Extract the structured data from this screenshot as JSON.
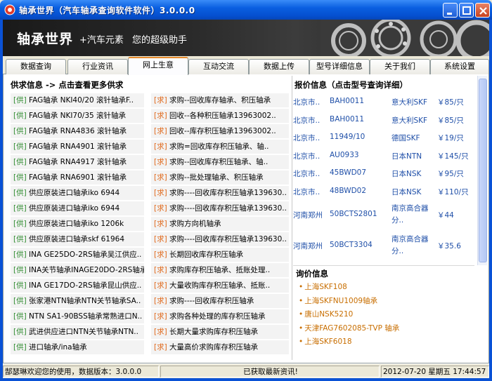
{
  "window": {
    "title": "轴承世界（汽车轴承查询软件软件）3.0.0.0",
    "icons": {
      "app": "bearing-app-icon",
      "minimize": "minimize-icon",
      "maximize": "maximize-icon",
      "close": "close-icon"
    }
  },
  "banner": {
    "brand": "轴承世界",
    "sub": "+汽车元素",
    "slogan": "您的超级助手"
  },
  "tabs": [
    {
      "label": "数据查询",
      "active": false
    },
    {
      "label": "行业资讯",
      "active": false
    },
    {
      "label": "网上生意",
      "active": true
    },
    {
      "label": "互动交流",
      "active": false
    },
    {
      "label": "数据上传",
      "active": false
    },
    {
      "label": "型号详细信息",
      "active": false
    },
    {
      "label": "关于我们",
      "active": false
    },
    {
      "label": "系统设置",
      "active": false
    }
  ],
  "supply_demand": {
    "header": "供求信息 -> 点击查看更多供求",
    "supply_tag": "[供]",
    "demand_tag": "[求]",
    "rows": [
      {
        "supply": "FAG轴承 NKI40/20 滚针轴承F..",
        "demand": "求购--回收库存轴承、积压轴承"
      },
      {
        "supply": "FAG轴承 NKI70/35 滚针轴承",
        "demand": "回收--各种积压轴承13963002.."
      },
      {
        "supply": "FAG轴承 RNA4836 滚针轴承",
        "demand": "回收--库存积压轴承13963002.."
      },
      {
        "supply": "FAG轴承 RNA4901 滚针轴承",
        "demand": "求购=回收库存积压轴承、轴.."
      },
      {
        "supply": "FAG轴承 RNA4917 滚针轴承",
        "demand": "求购--回收库存积压轴承、轴.."
      },
      {
        "supply": "FAG轴承 RNA6901 滚针轴承",
        "demand": "求购--批处理轴承、积压轴承"
      },
      {
        "supply": "供应原装进口轴承iko 6944",
        "demand": "求购----回收库存积压轴承139630.."
      },
      {
        "supply": "供应原装进口轴承iko 6944",
        "demand": "求购----回收库存积压轴承139630.."
      },
      {
        "supply": "供应原装进口轴承iko 1206k",
        "demand": "求购方向机轴承"
      },
      {
        "supply": "供应原装进口轴承skf 61964",
        "demand": "求购----回收库存积压轴承139630.."
      },
      {
        "supply": "INA GE25DO-2RS轴承吴江供应..",
        "demand": "长期回收库存积压轴承"
      },
      {
        "supply": "INA关节轴承INAGE20DO-2RS轴承",
        "demand": "求购库存积压轴承、抵账处理.."
      },
      {
        "supply": "INA GE17DO-2RS轴承昆山供应..",
        "demand": "大量收购库存积压轴承、抵账.."
      },
      {
        "supply": "张家港NTN轴承NTN关节轴承SA..",
        "demand": "求购----回收库存积压轴承"
      },
      {
        "supply": "NTN SA1-90BSS轴承常熟进口N..",
        "demand": "求购各种处理的库存积压轴承"
      },
      {
        "supply": "武进供应进口NTN关节轴承NTN..",
        "demand": "长期大量求购库存积压轴承"
      },
      {
        "supply": "进口轴承/ina轴承",
        "demand": "大量高价求购库存积压轴承"
      }
    ]
  },
  "quotes": {
    "header": "报价信息（点击型号查询详细）",
    "rows": [
      {
        "city": "北京市..",
        "model": "BAH0011",
        "brand": "意大利SKF",
        "price": "￥85/只"
      },
      {
        "city": "北京市..",
        "model": "BAH0011",
        "brand": "意大利SKF",
        "price": "￥85/只"
      },
      {
        "city": "北京市..",
        "model": "11949/10",
        "brand": "德国SKF",
        "price": "￥19/只"
      },
      {
        "city": "北京市..",
        "model": "AU0933",
        "brand": "日本NTN",
        "price": "￥145/只"
      },
      {
        "city": "北京市..",
        "model": "45BWD07",
        "brand": "日本NSK",
        "price": "￥95/只"
      },
      {
        "city": "北京市..",
        "model": "48BWD02",
        "brand": "日本NSK",
        "price": "￥110/只"
      },
      {
        "city": "河南郑州",
        "model": "50BCTS2801",
        "brand": "南京高合器分..",
        "price": "￥44"
      },
      {
        "city": "河南郑州",
        "model": "50BCT3304",
        "brand": "南京高合器分..",
        "price": "￥35.6"
      }
    ]
  },
  "inquiries": {
    "header": "询价信息",
    "items": [
      "上海SKF108",
      "上海SKFNU1009轴承",
      "唐山NSK5210",
      "天津FAG7602085-TVP 轴承",
      "上海SKF6018"
    ]
  },
  "status": {
    "welcome": "郜瑟琳欢迎您的使用，数据版本：3.0.0.0",
    "message": "已获取最新资讯!",
    "datetime": "2012-07-20 星期五  17:44:57 .."
  },
  "colors": {
    "title_blue": "#0A5FE0",
    "supply_tag": "#2E8B2E",
    "demand_tag": "#E0681A",
    "link_blue": "#1F4FA8",
    "inquiry_orange": "#C86E00",
    "active_tab": "#E68B2C"
  }
}
